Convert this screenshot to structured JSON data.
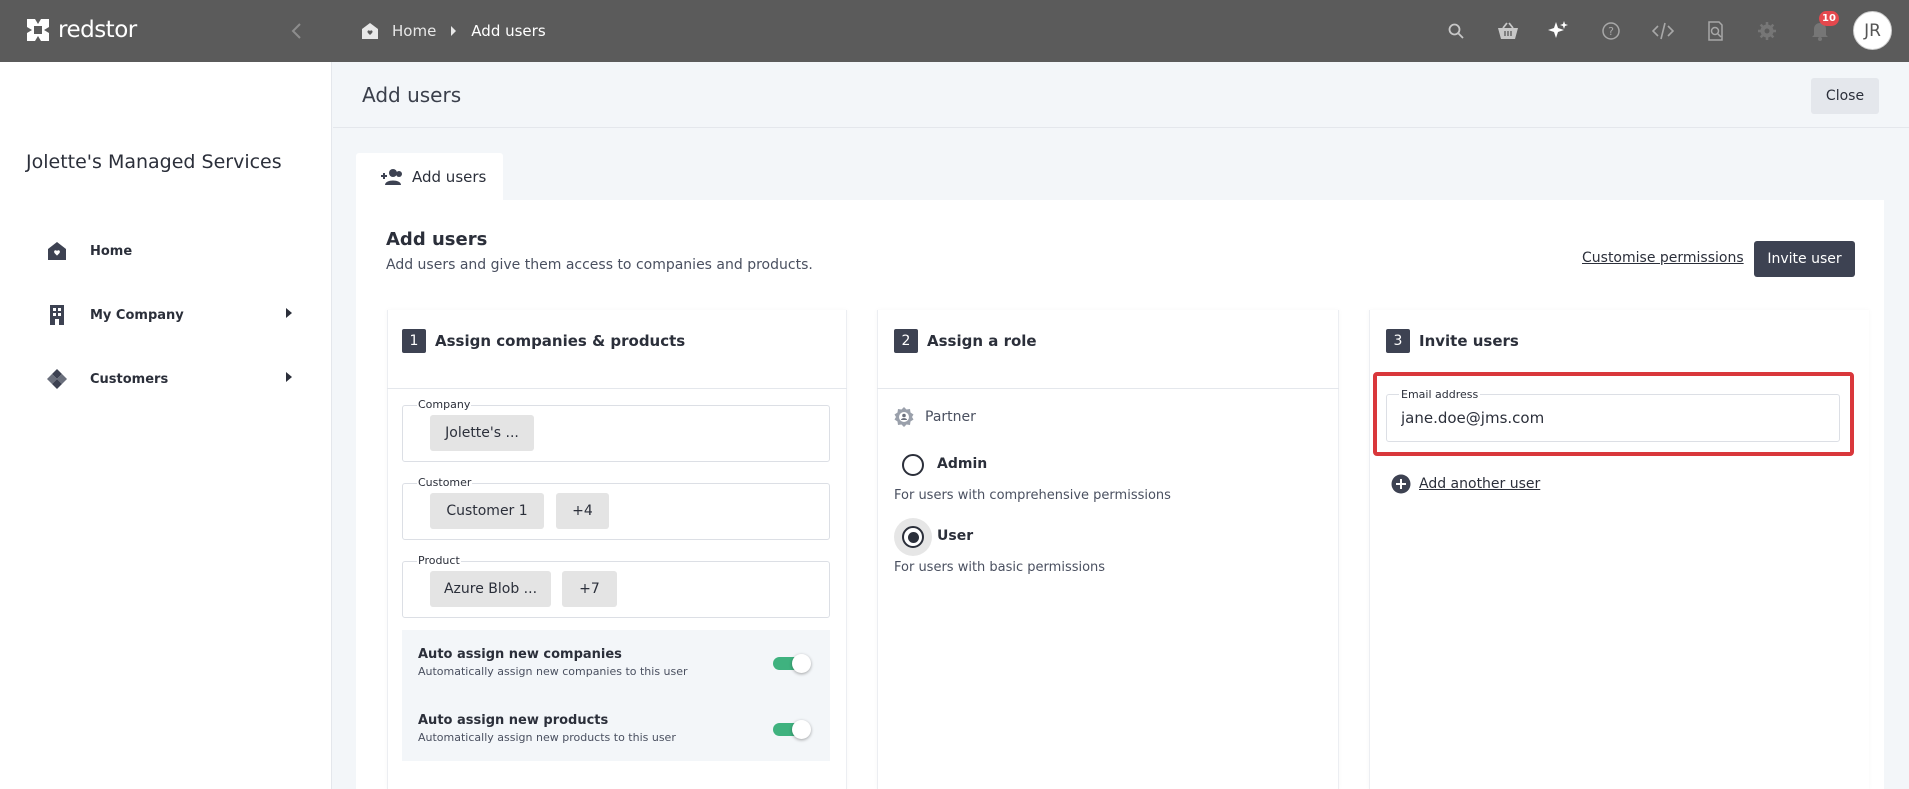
{
  "app": {
    "brand": "redstor"
  },
  "breadcrumb": {
    "home": "Home",
    "current": "Add users"
  },
  "topbar": {
    "notifications_count": "10",
    "avatar_initials": "JR"
  },
  "sidebar": {
    "org_name": "Jolette's Managed Services",
    "items": [
      {
        "label": "Home"
      },
      {
        "label": "My Company"
      },
      {
        "label": "Customers"
      }
    ]
  },
  "page": {
    "title": "Add users",
    "close_label": "Close"
  },
  "tab": {
    "label": "Add users"
  },
  "card": {
    "title": "Add users",
    "subtitle": "Add users and give them access to companies and products.",
    "customise_label": "Customise permissions",
    "invite_label": "Invite user"
  },
  "step1": {
    "number": "1",
    "title": "Assign companies & products",
    "company_label": "Company",
    "company_chip": "Jolette's ...",
    "customer_label": "Customer",
    "customer_chip": "Customer 1",
    "customer_more": "+4",
    "product_label": "Product",
    "product_chip": "Azure Blob ...",
    "product_more": "+7",
    "auto_companies_title": "Auto assign new companies",
    "auto_companies_sub": "Automatically assign new companies to this user",
    "auto_companies_on": true,
    "auto_products_title": "Auto assign new products",
    "auto_products_sub": "Automatically assign new products to this user",
    "auto_products_on": true
  },
  "step2": {
    "number": "2",
    "title": "Assign a role",
    "group": "Partner",
    "admin_label": "Admin",
    "admin_desc": "For users with comprehensive permissions",
    "user_label": "User",
    "user_desc": "For users with basic permissions",
    "selected": "User"
  },
  "step3": {
    "number": "3",
    "title": "Invite users",
    "email_label": "Email address",
    "email_value": "jane.doe@jms.com",
    "add_another": "Add another user"
  },
  "colors": {
    "topbar": "#5b5b5b",
    "primary_button": "#3d4252",
    "toggle_on": "#3fb27f",
    "highlight": "#d9373b",
    "badge": "#e5484d"
  }
}
